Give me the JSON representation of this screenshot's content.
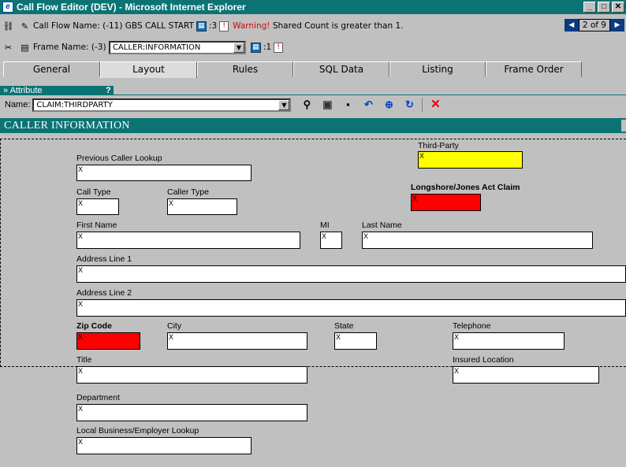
{
  "window": {
    "title": "Call Flow Editor (DEV) - Microsoft Internet Explorer",
    "icon": "ie-icon",
    "buttons": {
      "minimize": "_",
      "maximize": "□",
      "close": "✕"
    }
  },
  "callflow": {
    "label": "Call Flow Name:",
    "value": "(-11) GBS CALL START",
    "count": ":3",
    "warning_label": "Warning!",
    "warning_text": "Shared Count is greater than 1.",
    "pager": {
      "prev": "◀",
      "text": "2 of 9",
      "next": "▶"
    }
  },
  "frame": {
    "label": "Frame Name:",
    "value": "(-3)",
    "selected": "CALLER:INFORMATION",
    "count": ":1"
  },
  "tabs": [
    {
      "label": "General"
    },
    {
      "label": "Layout",
      "active": true
    },
    {
      "label": "Rules"
    },
    {
      "label": "SQL Data"
    },
    {
      "label": "Listing"
    },
    {
      "label": "Frame Order"
    }
  ],
  "attribute": {
    "label": "» Attribute",
    "help": "?"
  },
  "namebar": {
    "label": "Name:",
    "selected": "CLAIM:THIRDPARTY",
    "tools": [
      "binoculars-icon",
      "properties-icon",
      "save-icon",
      "undo-icon",
      "zoom-icon",
      "refresh-icon",
      "delete-icon"
    ]
  },
  "section": {
    "title": "CALLER INFORMATION"
  },
  "fields": {
    "third_party": {
      "label": "Third-Party",
      "value": "X"
    },
    "previous_caller_lookup": {
      "label": "Previous Caller Lookup",
      "value": "X"
    },
    "longshore": {
      "label": "Longshore/Jones Act Claim",
      "value": "X"
    },
    "call_type": {
      "label": "Call Type",
      "value": "X"
    },
    "caller_type": {
      "label": "Caller Type",
      "value": "X"
    },
    "first_name": {
      "label": "First Name",
      "value": "X"
    },
    "mi": {
      "label": "MI",
      "value": "X"
    },
    "last_name": {
      "label": "Last Name",
      "value": "X"
    },
    "address1": {
      "label": "Address Line 1",
      "value": "X"
    },
    "address2": {
      "label": "Address Line 2",
      "value": "X"
    },
    "zip": {
      "label": "Zip Code",
      "value": "X"
    },
    "city": {
      "label": "City",
      "value": "X"
    },
    "state": {
      "label": "State",
      "value": "X"
    },
    "telephone": {
      "label": "Telephone",
      "value": "X"
    },
    "title": {
      "label": "Title",
      "value": "X"
    },
    "insured_location": {
      "label": "Insured Location",
      "value": "X"
    },
    "department": {
      "label": "Department",
      "value": "X"
    },
    "local_business": {
      "label": "Local Business/Employer Lookup",
      "value": "X"
    }
  },
  "colors": {
    "teal": "#0b7373",
    "required": "#ff0000",
    "highlight": "#ffff00"
  }
}
